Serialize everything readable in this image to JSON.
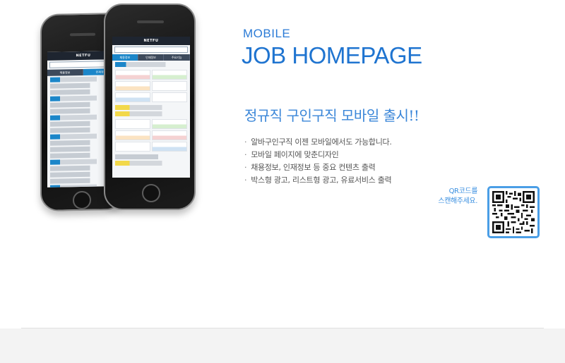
{
  "hero": {
    "eyebrow": "MOBILE",
    "title": "JOB HOMEPAGE",
    "release_headline": "정규직 구인구직 모바일 출시!!",
    "features": [
      "알바구인구직 이젠 모바일에서도 가능합니다.",
      "모바일 페이지에 맞춘디자인",
      "채용정보, 인재정보 등 중요 컨텐츠 출력",
      "박스형 광고, 리스트형 광고, 유료서비스 출력"
    ],
    "bullet": "·"
  },
  "qr": {
    "caption_line1": "QR코드를",
    "caption_line2": "스캔해주세요.",
    "icon": "qr-code-icon"
  },
  "phone_screen": {
    "logo": "NETFU",
    "tabs_front": [
      "채용정보",
      "인재정보",
      "주요기능"
    ],
    "tabs_back": [
      "채용정보",
      "인재정보"
    ]
  },
  "colors": {
    "accent": "#1f74d0",
    "headline": "#3a86d8",
    "qr_border": "#4a9ee6",
    "text": "#555555"
  }
}
